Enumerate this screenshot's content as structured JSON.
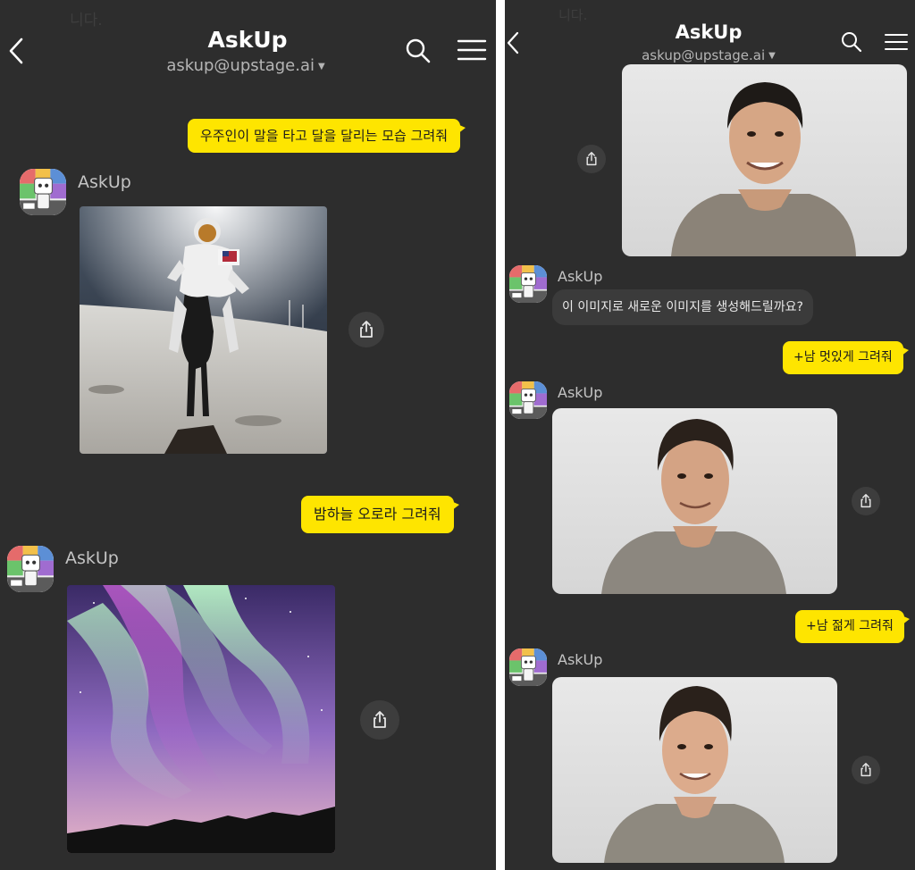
{
  "header": {
    "title": "AskUp",
    "subtitle": "askup@upstage.ai",
    "back_icon": "chevron-left-icon",
    "search_icon": "search-icon",
    "menu_icon": "hamburger-menu-icon"
  },
  "faded_top_text": "니다.",
  "bot_name": "AskUp",
  "colors": {
    "background": "#2d2d2d",
    "my_bubble": "#fee500",
    "bot_bubble": "#3b3b3b",
    "title_text": "#ffffff",
    "subtitle_text": "#b5b5b5"
  },
  "left_chat": {
    "msg1": "우주인이 말을 타고 달을 달리는 모습 그려줘",
    "image1": "astronaut riding a horse on the moon",
    "msg2": "밤하늘 오로라 그려줘",
    "image2": "aurora in the night sky"
  },
  "right_chat": {
    "image0": "portrait photo of a smiling man in a gray sweater",
    "bot_msg": "이 이미지로 새로운 이미지를 생성해드릴까요?",
    "msg1": "+남 멋있게 그려줘",
    "image1": "handsome version of the man",
    "msg2": "+남 젊게 그려줘",
    "image2": "younger version of the man"
  }
}
